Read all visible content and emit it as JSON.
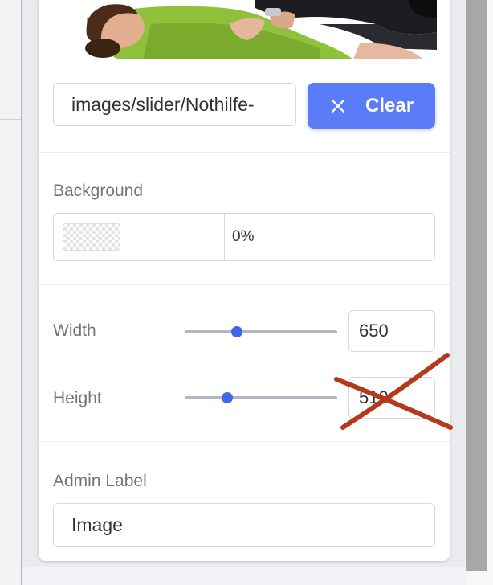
{
  "image": {
    "path_value": "images/slider/Nothilfe-",
    "clear_label": "Clear"
  },
  "background": {
    "label": "Background",
    "opacity_value": "0%"
  },
  "size": {
    "width_label": "Width",
    "width_value": "650",
    "width_slider_fraction": 0.34,
    "height_label": "Height",
    "height_value": "510",
    "height_slider_fraction": 0.28
  },
  "admin": {
    "label": "Admin Label",
    "value": "Image"
  },
  "colors": {
    "accent": "#5b7cf7",
    "slider_thumb": "#3f67e8",
    "annotation_cross": "#b53a1c"
  }
}
